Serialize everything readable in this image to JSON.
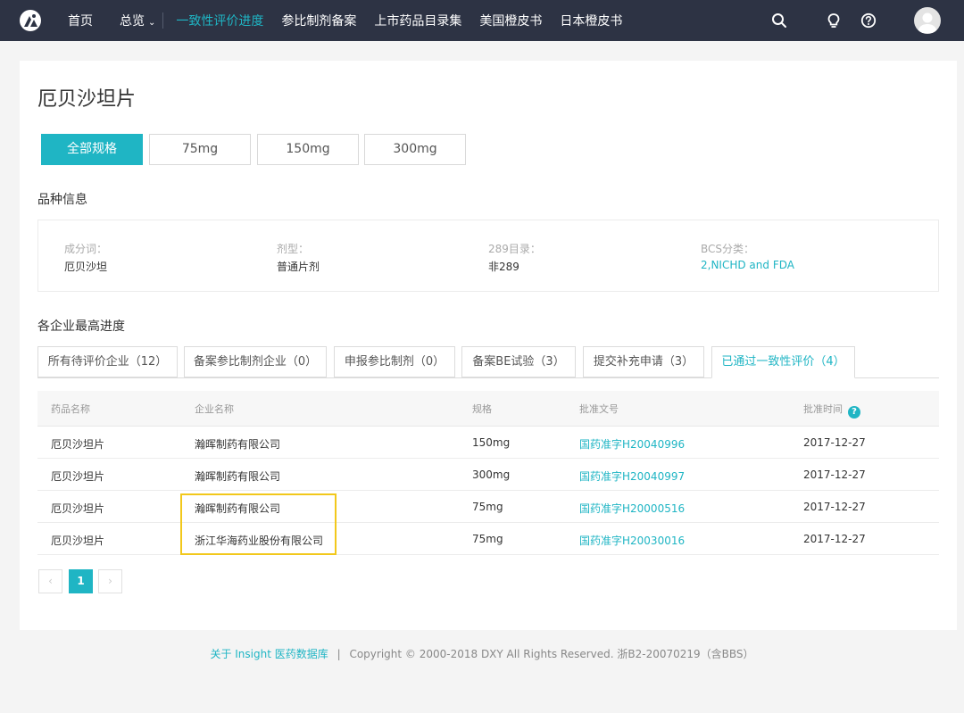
{
  "nav": {
    "items": [
      {
        "label": "首页"
      },
      {
        "label": "总览"
      },
      {
        "label": "一致性评价进度"
      },
      {
        "label": "参比制剂备案"
      },
      {
        "label": "上市药品目录集"
      },
      {
        "label": "美国橙皮书"
      },
      {
        "label": "日本橙皮书"
      }
    ],
    "active_index": 2,
    "accent": "#1fb5c4",
    "background": "#2d3344",
    "icons": [
      "search-icon",
      "lightbulb-icon",
      "help-icon",
      "avatar-icon"
    ]
  },
  "page": {
    "title": "厄贝沙坦片"
  },
  "specs": {
    "buttons": [
      "全部规格",
      "75mg",
      "150mg",
      "300mg"
    ],
    "active_index": 0
  },
  "info": {
    "section_title": "品种信息",
    "fields": [
      {
        "label": "成分词：",
        "value": "厄贝沙坦"
      },
      {
        "label": "剂型：",
        "value": "普通片剂"
      },
      {
        "label": "289目录：",
        "value": "非289"
      },
      {
        "label": "BCS分类：",
        "value": "2,NICHD and FDA"
      }
    ]
  },
  "progress": {
    "section_title": "各企业最高进度",
    "tabs": [
      "所有待评价企业（12）",
      "备案参比制剂企业（0）",
      "申报参比制剂（0）",
      "备案BE试验（3）",
      "提交补充申请（3）",
      "已通过一致性评价（4）"
    ],
    "active_index": 5
  },
  "table": {
    "headers": [
      "药品名称",
      "企业名称",
      "规格",
      "批准文号",
      "批准时间"
    ],
    "rows": [
      [
        "厄贝沙坦片",
        "瀚晖制药有限公司",
        "150mg",
        "国药准字H20040996",
        "2017-12-27"
      ],
      [
        "厄贝沙坦片",
        "瀚晖制药有限公司",
        "300mg",
        "国药准字H20040997",
        "2017-12-27"
      ],
      [
        "厄贝沙坦片",
        "瀚晖制药有限公司",
        "75mg",
        "国药准字H20000516",
        "2017-12-27"
      ],
      [
        "厄贝沙坦片",
        "浙江华海药业股份有限公司",
        "75mg",
        "国药准字H20030016",
        "2017-12-27"
      ]
    ]
  },
  "pagination": {
    "prev": "‹",
    "current": "1",
    "next": "›"
  },
  "footer": {
    "link": "关于 Insight 医药数据库",
    "sep": "|",
    "copyright": "Copyright © 2000-2018 DXY All Rights Reserved. 浙B2-20070219（含BBS）"
  }
}
